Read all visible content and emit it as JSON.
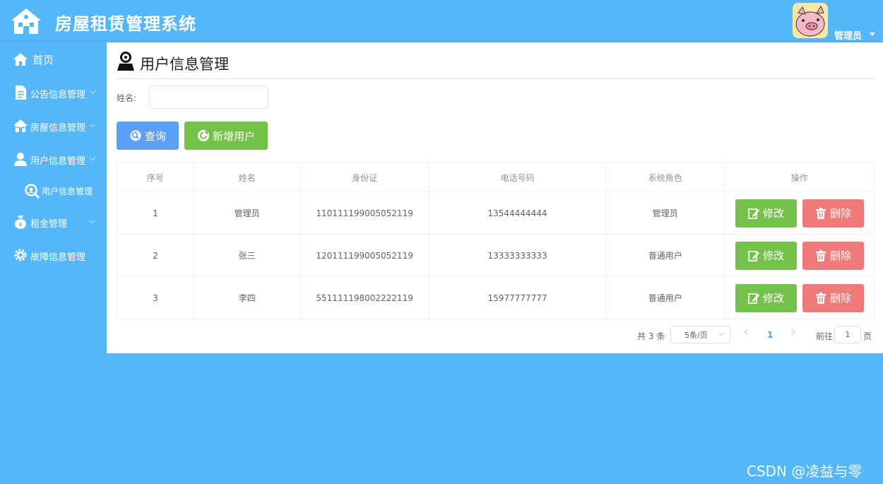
{
  "header": {
    "app_title": "房屋租赁管理系统",
    "user_name": "管理员"
  },
  "sidebar": {
    "items": [
      {
        "label": "首页",
        "icon": "home-icon"
      },
      {
        "label": "公告信息管理",
        "icon": "document-icon"
      },
      {
        "label": "房屋信息管理",
        "icon": "house-icon"
      },
      {
        "label": "用户信息管理",
        "icon": "user-icon"
      },
      {
        "label": "用户信息管理",
        "icon": "search-user-icon"
      },
      {
        "label": "租金管理",
        "icon": "money-bag-icon"
      },
      {
        "label": "故障信息管理",
        "icon": "gear-icon"
      }
    ]
  },
  "main": {
    "title": "用户信息管理",
    "search": {
      "label": "姓名:",
      "value": ""
    },
    "buttons": {
      "query": "查询",
      "add": "新增用户"
    },
    "table": {
      "headers": [
        "序号",
        "姓名",
        "身份证",
        "电话号码",
        "系统角色",
        "操作"
      ],
      "rows": [
        {
          "index": "1",
          "name": "管理员",
          "id_card": "110111199005052119",
          "phone": "13544444444",
          "role": "管理员"
        },
        {
          "index": "2",
          "name": "张三",
          "id_card": "120111199005052119",
          "phone": "13333333333",
          "role": "普通用户"
        },
        {
          "index": "3",
          "name": "李四",
          "id_card": "551111198002222119",
          "phone": "15977777777",
          "role": "普通用户"
        }
      ],
      "edit_label": "修改",
      "delete_label": "删除"
    },
    "pagination": {
      "total": "共 3 条",
      "page_size": "5条/页",
      "current": "1",
      "goto_label": "前往",
      "goto_value": "1",
      "page_suffix": "页"
    }
  },
  "watermark": "CSDN @凌益与零",
  "colors": {
    "primary_bg": "#55b7f7",
    "query_btn": "#5aa1f5",
    "success": "#75c24a",
    "danger": "#ee7b79"
  }
}
